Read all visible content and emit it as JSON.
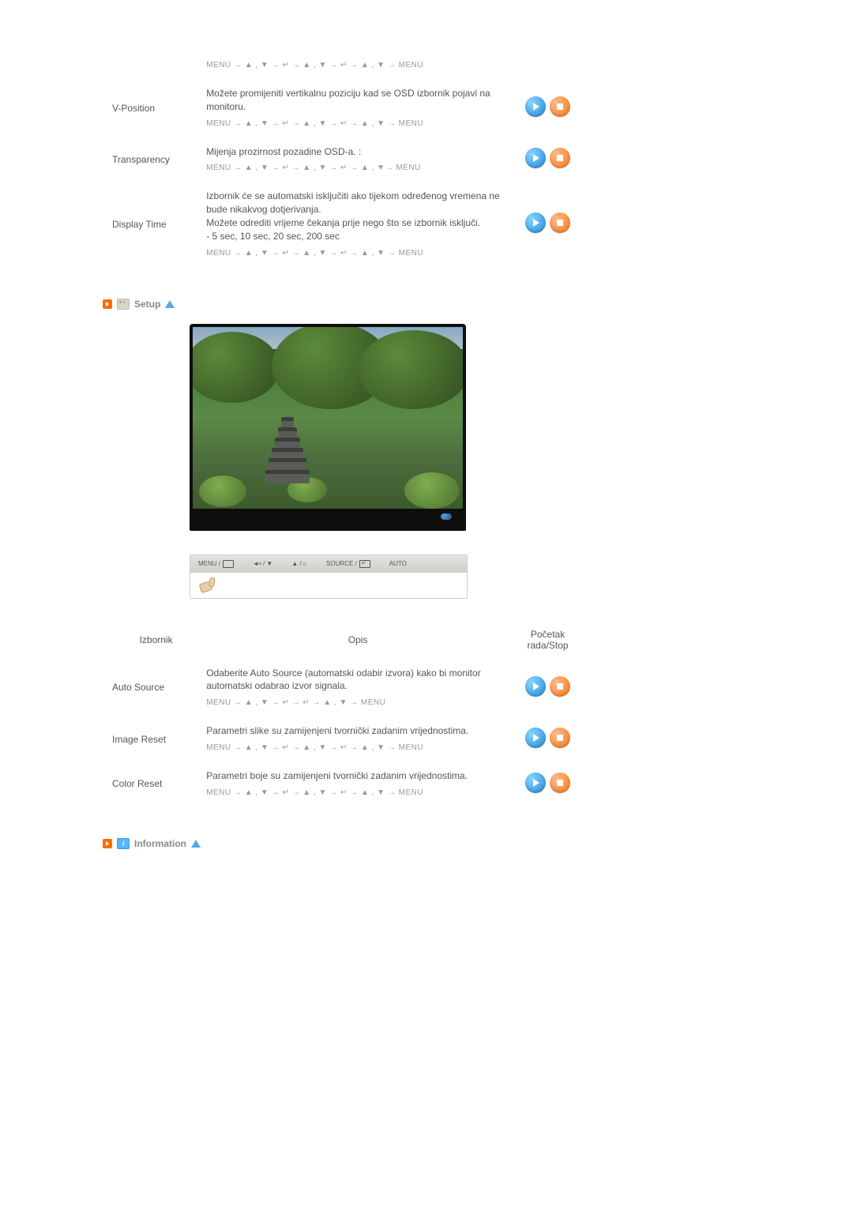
{
  "nav_sequences": {
    "s1": "MENU → ▲ , ▼ → ↵ → ▲ , ▼ → ↵ → ▲ , ▼ → MENU",
    "s2": "MENU → ▲ , ▼ → ↵ → ▲ , ▼ → ↵ → ▲ , ▼ → MENU",
    "s3": "MENU → ▲ , ▼ → ↵ → ▲ , ▼ → ↵ → ▲ , ▼→ MENU",
    "s4": "MENU → ▲ , ▼ → ↵ → ▲ , ▼ → ↵ → ▲ , ▼ → MENU",
    "s5": "MENU → ▲ , ▼ → ↵ → ↵ → ▲ , ▼ → MENU",
    "s6": "MENU → ▲ , ▼ → ↵ → ▲ , ▼ → ↵ → ▲ , ▼ → MENU",
    "s7": "MENU → ▲ , ▼ → ↵ → ▲ , ▼ → ↵ → ▲ , ▼ → MENU"
  },
  "rows": {
    "vposition": {
      "label": "V-Position",
      "desc": "Možete promijeniti vertikalnu poziciju kad se OSD izbornik pojavi na monitoru."
    },
    "transparency": {
      "label": "Transparency",
      "desc": "Mijenja prozirnost pozadine OSD-a.   :"
    },
    "displaytime": {
      "label": "Display Time",
      "desc1": "Izbornik će se automatski isključiti ako tijekom određenog vremena ne bude nikakvog dotjerivanja.",
      "desc2": "Možete odrediti vrijeme čekanja prije nego što se izbornik isključi.",
      "desc3": "- 5 sec, 10 sec, 20 sec, 200 sec"
    },
    "autosource": {
      "label": "Auto Source",
      "desc": "Odaberite Auto Source (automatski odabir izvora) kako bi monitor automatski odabrao izvor signala."
    },
    "imagereset": {
      "label": "Image Reset",
      "desc": "Parametri slike su zamijenjeni tvornički zadanim vrijednostima."
    },
    "colorreset": {
      "label": "Color Reset",
      "desc": "Parametri boje su zamijenjeni tvornički zadanim vrijednostima."
    }
  },
  "sections": {
    "setup": "Setup",
    "information": "Information"
  },
  "table_headers": {
    "izbornik": "Izbornik",
    "opis": "Opis",
    "pocetak": "Početak rada/Stop"
  },
  "buttonbar": {
    "menu": "MENU /",
    "source": "SOURCE /",
    "auto": "AUTO"
  }
}
